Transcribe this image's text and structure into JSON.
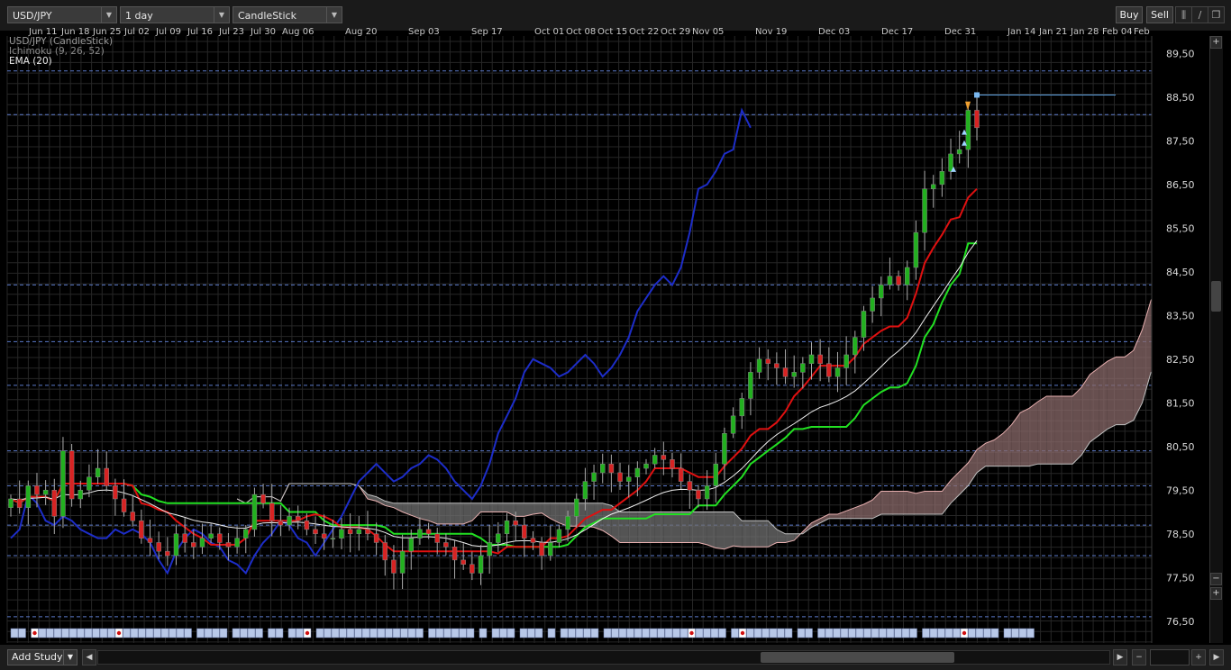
{
  "toolbar": {
    "symbol": "USD/JPY",
    "interval": "1 day",
    "chart_style": "CandleStick",
    "buy_label": "Buy",
    "sell_label": "Sell"
  },
  "legend": {
    "main": "USD/JPY (CandleStick)",
    "ichimoku": "Ichimoku (9, 26, 52)",
    "ema": "EMA (20)"
  },
  "bottom": {
    "add_study_label": "Add Study"
  },
  "colors": {
    "background": "#000000",
    "grid": "#262626",
    "up_candle": "#22b01f",
    "down_candle": "#d72323",
    "tenkan": "#e01010",
    "kijun": "#22e022",
    "chikou": "#1d2dc8",
    "ema": "#f0f0f0",
    "cloud_bullish": "#8a6a6a",
    "cloud_bearish": "#707070",
    "level_line": "#5a78c8",
    "price_line": "#5aa0e0"
  },
  "chart_data": {
    "type": "candlestick",
    "symbol": "USD/JPY",
    "interval": "1 day",
    "x_ticks": [
      "Jun 11",
      "Jun 18",
      "Jun 25",
      "Jul 02",
      "Jul 09",
      "Jul 16",
      "Jul 23",
      "Jul 30",
      "Aug 06",
      "Aug 20",
      "Sep 03",
      "Sep 17",
      "Oct 01",
      "Oct 08",
      "Oct 15",
      "Oct 22",
      "Oct 29",
      "Nov 05",
      "Nov 19",
      "Dec 03",
      "Dec 17",
      "Dec 31",
      "Jan 14",
      "Jan 21",
      "Jan 28",
      "Feb 04",
      "Feb"
    ],
    "y_ticks": [
      "89,50",
      "88,50",
      "87,50",
      "86,50",
      "85,50",
      "84,50",
      "83,50",
      "82,50",
      "81,50",
      "80,50",
      "79,50",
      "78,50",
      "77,50",
      "76,50"
    ],
    "ylim": [
      76.0,
      89.9
    ],
    "grid": true,
    "legend_position": "top-left",
    "level_lines": [
      89.1,
      88.1,
      84.2,
      82.9,
      81.9,
      80.4,
      79.6,
      78.7,
      78.0,
      76.6
    ],
    "current_price_line": 88.55,
    "series": [
      {
        "name": "Close",
        "values": [
          79.3,
          79.1,
          79.6,
          79.4,
          79.5,
          78.9,
          80.4,
          79.3,
          79.5,
          79.8,
          80.0,
          79.6,
          79.3,
          79.0,
          78.8,
          78.4,
          78.3,
          78.1,
          78.0,
          78.5,
          78.3,
          78.2,
          78.4,
          78.5,
          78.3,
          78.2,
          78.4,
          78.6,
          79.4,
          79.2,
          78.8,
          78.7,
          78.9,
          78.8,
          78.6,
          78.5,
          78.4,
          78.4,
          78.6,
          78.5,
          78.6,
          78.5,
          78.3,
          77.9,
          77.6,
          78.1,
          78.4,
          78.6,
          78.5,
          78.3,
          78.2,
          77.9,
          77.8,
          77.6,
          78.0,
          78.3,
          78.5,
          78.8,
          78.7,
          78.4,
          78.3,
          78.0,
          78.3,
          78.6,
          78.9,
          79.3,
          79.7,
          79.9,
          80.1,
          79.9,
          79.7,
          79.8,
          80.0,
          80.1,
          80.3,
          80.2,
          80.0,
          79.7,
          79.5,
          79.3,
          79.6,
          80.1,
          80.8,
          81.2,
          81.6,
          82.2,
          82.5,
          82.4,
          82.3,
          82.1,
          82.2,
          82.4,
          82.6,
          82.4,
          82.1,
          82.3,
          82.6,
          83.0,
          83.6,
          83.9,
          84.2,
          84.4,
          84.2,
          84.6,
          85.4,
          86.4,
          86.5,
          86.8,
          87.2,
          87.3,
          88.2,
          87.8
        ]
      }
    ]
  }
}
